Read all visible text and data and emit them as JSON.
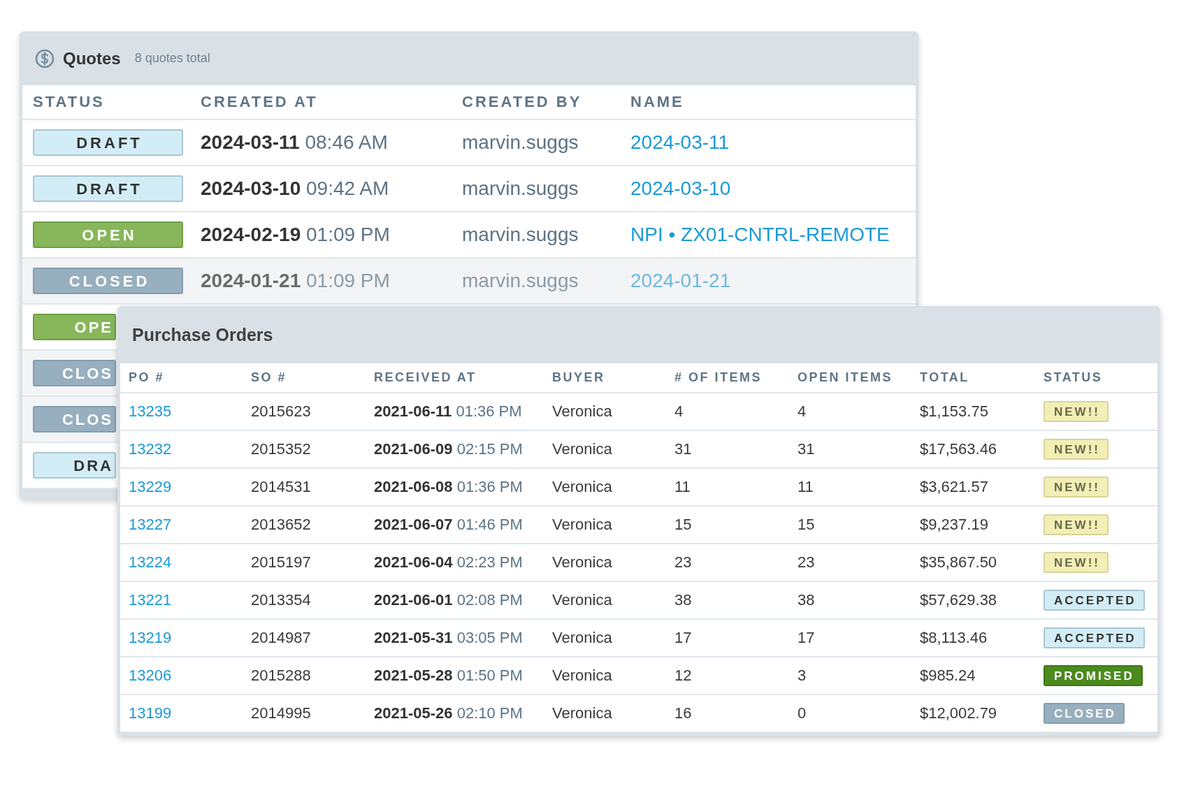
{
  "quotes": {
    "title": "Quotes",
    "count": "8 quotes total",
    "columns": [
      "STATUS",
      "CREATED AT",
      "CREATED BY",
      "NAME"
    ],
    "rows": [
      {
        "status": "DRAFT",
        "kind": "draft",
        "created_at": "**2024-03-11** 08:46 AM",
        "created_by": "marvin.suggs",
        "name": "2024-03-11"
      },
      {
        "status": "DRAFT",
        "kind": "draft",
        "created_at": "**2024-03-10** 09:42 AM",
        "created_by": "marvin.suggs",
        "name": "2024-03-10"
      },
      {
        "status": "OPEN",
        "kind": "open",
        "created_at": "**2024-02-19** 01:09 PM",
        "created_by": "marvin.suggs",
        "name": "NPI • ZX01-CNTRL-REMOTE"
      },
      {
        "status": "CLOSED",
        "kind": "closed",
        "created_at": "**2024-01-21** 01:09 PM",
        "created_by": "marvin.suggs",
        "name": "2024-01-21"
      },
      {
        "status": "OPE",
        "kind": "open"
      },
      {
        "status": "CLOS",
        "kind": "closed"
      },
      {
        "status": "CLOS",
        "kind": "closed"
      },
      {
        "status": "DRA",
        "kind": "draft"
      }
    ]
  },
  "purchase_orders": {
    "title": "Purchase Orders",
    "columns": [
      "PO #",
      "SO #",
      "RECEIVED AT",
      "BUYER",
      "# OF ITEMS",
      "OPEN ITEMS",
      "TOTAL",
      "STATUS"
    ],
    "rows": [
      {
        "po": "13235",
        "so": "2015623",
        "received_at": "**2021-06-11** 01:36 PM",
        "buyer": "Veronica",
        "items": "4",
        "open_items": "4",
        "total": "$1,153.75",
        "status": "NEW!!",
        "kind": "new"
      },
      {
        "po": "13232",
        "so": "2015352",
        "received_at": "**2021-06-09** 02:15 PM",
        "buyer": "Veronica",
        "items": "31",
        "open_items": "31",
        "total": "$17,563.46",
        "status": "NEW!!",
        "kind": "new"
      },
      {
        "po": "13229",
        "so": "2014531",
        "received_at": "**2021-06-08** 01:36 PM",
        "buyer": "Veronica",
        "items": "11",
        "open_items": "11",
        "total": "$3,621.57",
        "status": "NEW!!",
        "kind": "new"
      },
      {
        "po": "13227",
        "so": "2013652",
        "received_at": "**2021-06-07** 01:46 PM",
        "buyer": "Veronica",
        "items": "15",
        "open_items": "15",
        "total": "$9,237.19",
        "status": "NEW!!",
        "kind": "new"
      },
      {
        "po": "13224",
        "so": "2015197",
        "received_at": "**2021-06-04** 02:23 PM",
        "buyer": "Veronica",
        "items": "23",
        "open_items": "23",
        "total": "$35,867.50",
        "status": "NEW!!",
        "kind": "new"
      },
      {
        "po": "13221",
        "so": "2013354",
        "received_at": "**2021-06-01** 02:08 PM",
        "buyer": "Veronica",
        "items": "38",
        "open_items": "38",
        "total": "$57,629.38",
        "status": "ACCEPTED",
        "kind": "accepted"
      },
      {
        "po": "13219",
        "so": "2014987",
        "received_at": "**2021-05-31** 03:05 PM",
        "buyer": "Veronica",
        "items": "17",
        "open_items": "17",
        "total": "$8,113.46",
        "status": "ACCEPTED",
        "kind": "accepted"
      },
      {
        "po": "13206",
        "so": "2015288",
        "received_at": "**2021-05-28** 01:50 PM",
        "buyer": "Veronica",
        "items": "12",
        "open_items": "3",
        "total": "$985.24",
        "status": "PROMISED",
        "kind": "promised"
      },
      {
        "po": "13199",
        "so": "2014995",
        "received_at": "**2021-05-26** 02:10 PM",
        "buyer": "Veronica",
        "items": "16",
        "open_items": "0",
        "total": "$12,002.79",
        "status": "CLOSED",
        "kind": "closed"
      }
    ]
  }
}
